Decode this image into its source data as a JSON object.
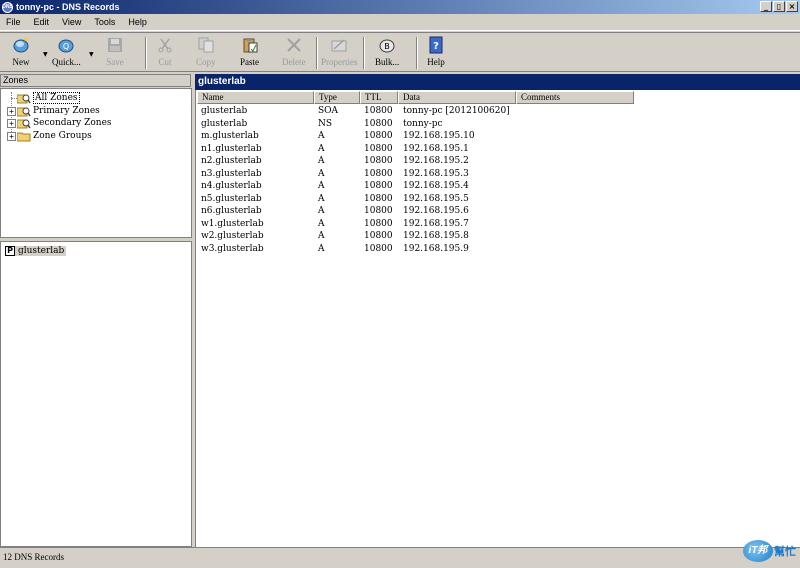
{
  "window": {
    "app_icon_text": "DNS",
    "title": "tonny-pc - DNS Records",
    "controls": [
      "_",
      "▯",
      "×"
    ]
  },
  "menu": [
    "File",
    "Edit",
    "View",
    "Tools",
    "Help"
  ],
  "toolbar": {
    "new": "New",
    "quick": "Quick...",
    "save": "Save",
    "cut": "Cut",
    "copy": "Copy",
    "paste": "Paste",
    "delete": "Delete",
    "properties": "Properties",
    "bulk": "Bulk...",
    "help": "Help"
  },
  "zones": {
    "header": "Zones",
    "items": [
      "All Zones",
      "Primary Zones",
      "Secondary Zones",
      "Zone Groups"
    ]
  },
  "selected_zone": {
    "icon_letter": "P",
    "label": "glusterlab"
  },
  "records": {
    "title": "glusterlab",
    "columns": [
      "Name",
      "Type",
      "TTL",
      "Data",
      "Comments"
    ],
    "rows": [
      [
        "glusterlab",
        "SOA",
        "10800",
        "tonny-pc [2012100620]",
        ""
      ],
      [
        "glusterlab",
        "NS",
        "10800",
        "tonny-pc",
        ""
      ],
      [
        "m.glusterlab",
        "A",
        "10800",
        "192.168.195.10",
        ""
      ],
      [
        "n1.glusterlab",
        "A",
        "10800",
        "192.168.195.1",
        ""
      ],
      [
        "n2.glusterlab",
        "A",
        "10800",
        "192.168.195.2",
        ""
      ],
      [
        "n3.glusterlab",
        "A",
        "10800",
        "192.168.195.3",
        ""
      ],
      [
        "n4.glusterlab",
        "A",
        "10800",
        "192.168.195.4",
        ""
      ],
      [
        "n5.glusterlab",
        "A",
        "10800",
        "192.168.195.5",
        ""
      ],
      [
        "n6.glusterlab",
        "A",
        "10800",
        "192.168.195.6",
        ""
      ],
      [
        "w1.glusterlab",
        "A",
        "10800",
        "192.168.195.7",
        ""
      ],
      [
        "w2.glusterlab",
        "A",
        "10800",
        "192.168.195.8",
        ""
      ],
      [
        "w3.glusterlab",
        "A",
        "10800",
        "192.168.195.9",
        ""
      ]
    ]
  },
  "status": "12 DNS Records",
  "watermark": {
    "badge": "iT邦",
    "text": "幫忙"
  }
}
